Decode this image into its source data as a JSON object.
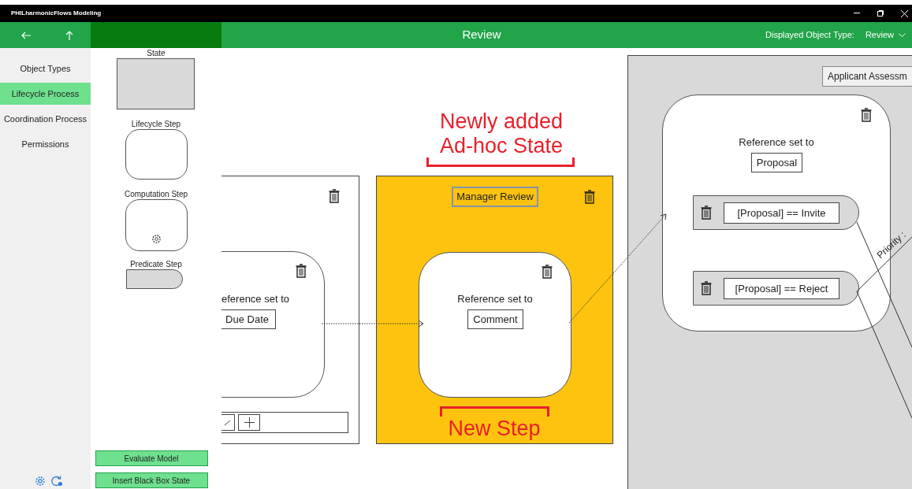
{
  "window": {
    "title": "PHILharmonicFlows Modeling"
  },
  "header": {
    "title": "Review",
    "object_type_label": "Displayed Object Type:",
    "object_type_value": "Review"
  },
  "sidebar": {
    "items": [
      {
        "label": "Object Types",
        "selected": false
      },
      {
        "label": "Lifecycle Process",
        "selected": true
      },
      {
        "label": "Coordination Process",
        "selected": false
      },
      {
        "label": "Permissions",
        "selected": false
      }
    ]
  },
  "toolbox": {
    "items": [
      {
        "label": "State",
        "kind": "state"
      },
      {
        "label": "Lifecycle Step",
        "kind": "lifecycle_step"
      },
      {
        "label": "Computation Step",
        "kind": "computation_step"
      },
      {
        "label": "Predicate Step",
        "kind": "predicate_step"
      }
    ],
    "buttons": [
      "Evaluate Model",
      "Insert Black Box State"
    ]
  },
  "canvas": {
    "states": [
      {
        "color": "#ffffff",
        "toolbar": true,
        "steps": [
          {
            "reference_label": "eference set to",
            "reference_value": "Due Date"
          }
        ]
      },
      {
        "color": "#fdc30f",
        "title": "Manager Review",
        "steps": [
          {
            "reference_label": "Reference set to",
            "reference_value": "Comment"
          }
        ]
      },
      {
        "color": "#d9d9d9",
        "title": "Applicant Assessm",
        "steps": [
          {
            "reference_label": "Reference set to",
            "reference_value": "Proposal",
            "predicates": [
              "[Proposal] == Invite",
              "[Proposal] == Reject"
            ]
          }
        ]
      }
    ],
    "edge_labels": [
      "Priority :"
    ],
    "annotations": [
      {
        "kind": "bracket_below",
        "lines": [
          "Newly added",
          "Ad-hoc State"
        ]
      },
      {
        "kind": "bracket_above",
        "lines": [
          "New Step"
        ]
      }
    ]
  }
}
